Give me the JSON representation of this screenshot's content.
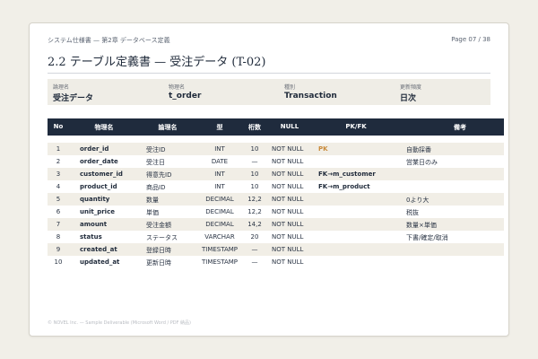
{
  "header": {
    "doc_title": "システム仕様書 — 第2章 データベース定義",
    "page_label": "Page 07 / 38"
  },
  "section_title": "2.2  テーブル定義書 — 受注データ (T-02)",
  "meta": [
    {
      "label": "論理名",
      "value": "受注データ"
    },
    {
      "label": "物理名",
      "value": "t_order"
    },
    {
      "label": "種別",
      "value": "Transaction"
    },
    {
      "label": "更新頻度",
      "value": "日次"
    }
  ],
  "table": {
    "headers": {
      "no": "No",
      "physical": "物理名",
      "logical": "論理名",
      "type": "型",
      "length": "桁数",
      "null": "NULL",
      "key": "PK/FK",
      "note": "備考"
    },
    "rows": [
      {
        "no": "1",
        "physical": "order_id",
        "logical": "受注ID",
        "type": "INT",
        "length": "10",
        "null": "NOT NULL",
        "key": "PK",
        "note": "自動採番"
      },
      {
        "no": "2",
        "physical": "order_date",
        "logical": "受注日",
        "type": "DATE",
        "length": "—",
        "null": "NOT NULL",
        "key": "",
        "note": "営業日のみ"
      },
      {
        "no": "3",
        "physical": "customer_id",
        "logical": "得意先ID",
        "type": "INT",
        "length": "10",
        "null": "NOT NULL",
        "key": "FK→m_customer",
        "note": ""
      },
      {
        "no": "4",
        "physical": "product_id",
        "logical": "商品ID",
        "type": "INT",
        "length": "10",
        "null": "NOT NULL",
        "key": "FK→m_product",
        "note": ""
      },
      {
        "no": "5",
        "physical": "quantity",
        "logical": "数量",
        "type": "DECIMAL",
        "length": "12,2",
        "null": "NOT NULL",
        "key": "",
        "note": "0より大"
      },
      {
        "no": "6",
        "physical": "unit_price",
        "logical": "単価",
        "type": "DECIMAL",
        "length": "12,2",
        "null": "NOT NULL",
        "key": "",
        "note": "税抜"
      },
      {
        "no": "7",
        "physical": "amount",
        "logical": "受注金額",
        "type": "DECIMAL",
        "length": "14,2",
        "null": "NOT NULL",
        "key": "",
        "note": "数量×単価"
      },
      {
        "no": "8",
        "physical": "status",
        "logical": "ステータス",
        "type": "VARCHAR",
        "length": "20",
        "null": "NOT NULL",
        "key": "",
        "note": "下書/確定/取消"
      },
      {
        "no": "9",
        "physical": "created_at",
        "logical": "登録日時",
        "type": "TIMESTAMP",
        "length": "—",
        "null": "NOT NULL",
        "key": "",
        "note": ""
      },
      {
        "no": "10",
        "physical": "updated_at",
        "logical": "更新日時",
        "type": "TIMESTAMP",
        "length": "—",
        "null": "NOT NULL",
        "key": "",
        "note": ""
      }
    ]
  },
  "footer": "© NOVEL Inc. — Sample Deliverable (Microsoft Word / PDF 納品)",
  "colors": {
    "header_bg": "#1f2b3d",
    "pk_accent": "#c98a3a",
    "row_alt_bg": "#f1eee6"
  }
}
